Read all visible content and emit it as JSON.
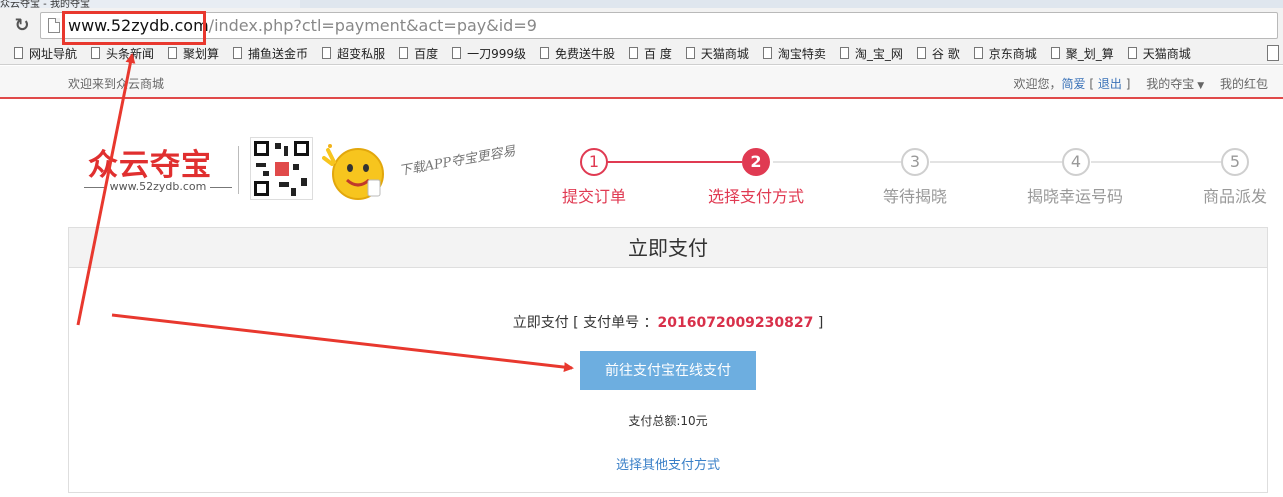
{
  "browser": {
    "tab_title": "众云夺宝 - 我的夺宝",
    "url_host": "www.52zydb.com",
    "url_path": "/index.php?ctl=payment&act=pay&id=9",
    "bookmarks": [
      {
        "label": "网址导航"
      },
      {
        "label": "头条新闻"
      },
      {
        "label": "聚划算"
      },
      {
        "label": "捕鱼送金币"
      },
      {
        "label": "超变私服"
      },
      {
        "label": "百度"
      },
      {
        "label": "一刀999级"
      },
      {
        "label": "免费送牛股"
      },
      {
        "label": "百 度"
      },
      {
        "label": "天猫商城"
      },
      {
        "label": "淘宝特卖"
      },
      {
        "label": "淘_宝_网"
      },
      {
        "label": "谷 歌"
      },
      {
        "label": "京东商城"
      },
      {
        "label": "聚_划_算"
      },
      {
        "label": "天猫商城"
      }
    ]
  },
  "topbar": {
    "welcome": "欢迎来到众云商城",
    "greeting": "欢迎您，",
    "username": "简爱",
    "logout": "退出",
    "my_duobao": "我的夺宝",
    "my_hongbao": "我的红包"
  },
  "header": {
    "logo_text": "众云夺宝",
    "logo_url": "www.52zydb.com",
    "slogan": "下载APP夺宝更容易"
  },
  "steps": [
    {
      "num": "1",
      "label": "提交订单",
      "state": "done"
    },
    {
      "num": "2",
      "label": "选择支付方式",
      "state": "active"
    },
    {
      "num": "3",
      "label": "等待揭晓",
      "state": "todo"
    },
    {
      "num": "4",
      "label": "揭晓幸运号码",
      "state": "todo"
    },
    {
      "num": "5",
      "label": "商品派发",
      "state": "todo"
    }
  ],
  "panel": {
    "title": "立即支付",
    "order_prefix": "立即支付 [  支付单号 ：",
    "order_number": "2016072009230827",
    "order_suffix": "  ]",
    "pay_button": "前往支付宝在线支付",
    "total": "支付总额:10元",
    "other_method": "选择其他支付方式"
  },
  "colors": {
    "accent_red": "#e03a52",
    "pay_button_blue": "#6daee0",
    "annotation_red": "#e8382e"
  }
}
